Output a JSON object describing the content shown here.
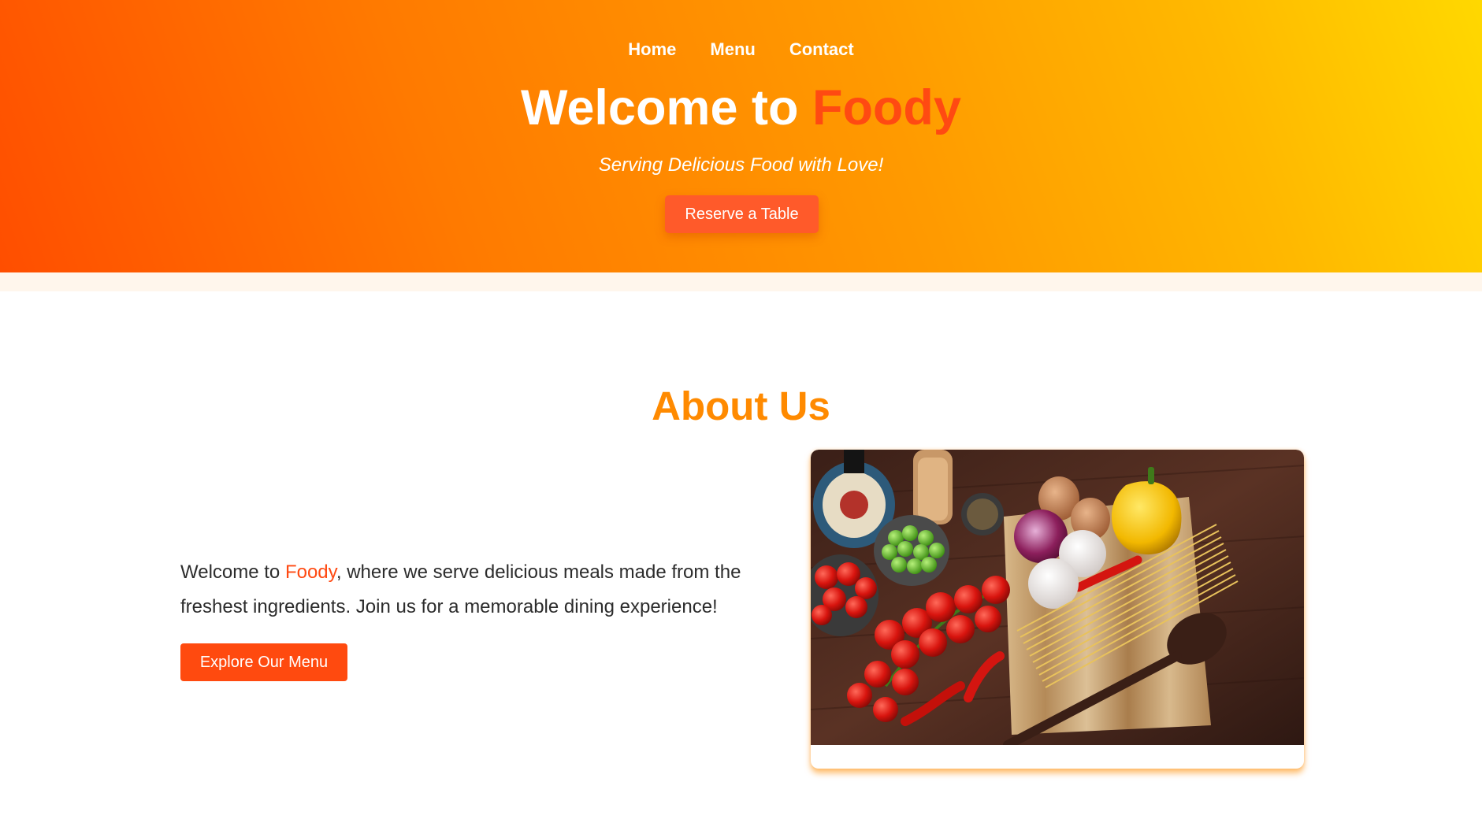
{
  "nav": {
    "items": [
      "Home",
      "Menu",
      "Contact"
    ]
  },
  "hero": {
    "title_prefix": "Welcome to ",
    "title_brand": "Foody",
    "tagline": "Serving Delicious Food with Love!",
    "cta_label": "Reserve a Table"
  },
  "about": {
    "heading": "About Us",
    "text_prefix": "Welcome to ",
    "text_brand": "Foody",
    "text_suffix": ", where we serve delicious meals made from the freshest ingredients. Join us for a memorable dining experience!",
    "cta_label": "Explore Our Menu",
    "image_alt": "Fresh ingredients: tomatoes, peppers, garlic, onion, peas, spaghetti on a cutting board"
  },
  "colors": {
    "brand_red": "#ff4a12",
    "about_heading": "#ff8a00",
    "gradient_start": "#ff4e00",
    "gradient_end": "#ffd800",
    "button_bg": "#ff4a0f"
  }
}
